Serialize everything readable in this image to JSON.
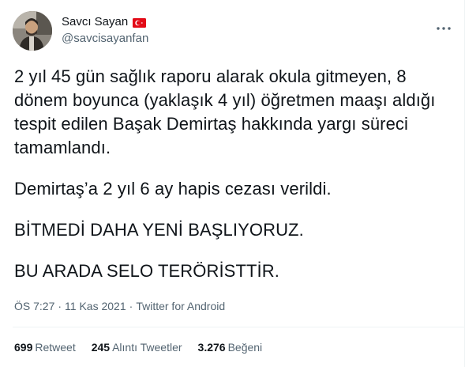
{
  "user": {
    "display_name": "Savcı Sayan",
    "handle": "@savcisayanfan",
    "flag_icon": "turkish-flag-icon",
    "flag_color": "#e30a17"
  },
  "tweet": {
    "paragraphs": [
      "2 yıl 45 gün sağlık raporu alarak okula gitmeyen, 8 dönem boyunca (yaklaşık 4 yıl) öğretmen maaşı aldığı tespit edilen Başak Demirtaş hakkında yargı süreci tamamlandı.",
      "Demirtaş’a 2 yıl 6 ay hapis cezası verildi.",
      "BİTMEDİ DAHA YENİ BAŞLIYORUZ.",
      "BU ARADA SELO TERÖRİSTTİR."
    ]
  },
  "meta": {
    "time": "ÖS 7:27",
    "separator": "·",
    "date": "11 Kas 2021",
    "source": "Twitter for Android"
  },
  "stats": {
    "retweets_count": "699",
    "retweets_label": "Retweet",
    "quotes_count": "245",
    "quotes_label": "Alıntı Tweetler",
    "likes_count": "3.276",
    "likes_label": "Beğeni"
  },
  "icons": {
    "more": "more-options-icon"
  },
  "colors": {
    "text_primary": "#0f1419",
    "text_secondary": "#536471",
    "divider": "#eff3f4"
  }
}
